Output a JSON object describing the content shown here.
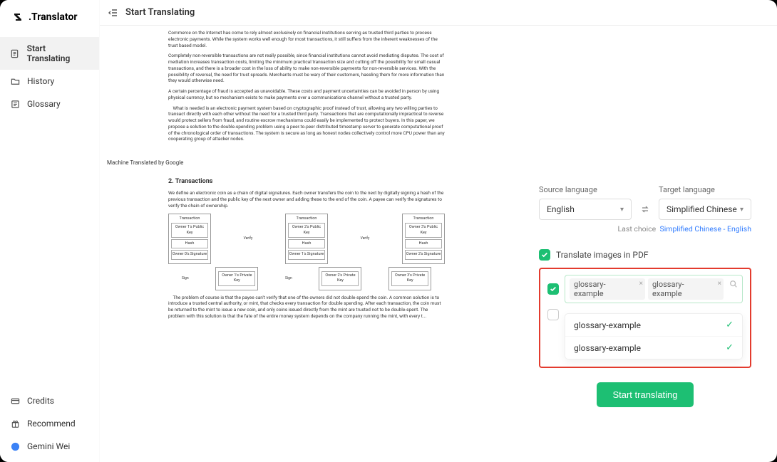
{
  "app_name": ".Translator",
  "topbar_title": "Start Translating",
  "sidebar": {
    "items": [
      {
        "label": "Start Translating",
        "icon": "document-icon",
        "active": true
      },
      {
        "label": "History",
        "icon": "folder-icon",
        "active": false
      },
      {
        "label": "Glossary",
        "icon": "list-icon",
        "active": false
      }
    ],
    "bottom": [
      {
        "label": "Credits",
        "icon": "card-icon"
      },
      {
        "label": "Recommend",
        "icon": "gift-icon"
      },
      {
        "label": "Gemini Wei",
        "icon": "avatar-icon"
      }
    ]
  },
  "document": {
    "para1": "Commerce on the Internet has come to rely almost exclusively on financial institutions serving as trusted third parties to process electronic payments. While the system works well enough for most transactions, it still suffers from the inherent weaknesses of the trust based model.",
    "para2": "Completely non-reversible transactions are not really possible, since financial institutions cannot avoid mediating disputes. The cost of mediation increases transaction costs, limiting the minimum practical transaction size and cutting off the possibility for small casual transactions, and there is a broader cost in the loss of ability to make non-reversible payments for non-reversible services. With the possibility of reversal, the need for trust spreads. Merchants must be wary of their customers, hassling them for more information than they would otherwise need.",
    "para3": "A certain percentage of fraud is accepted as unavoidable. These costs and payment uncertainties can be avoided in person by using physical currency, but no mechanism exists to make payments over a communications channel without a trusted party.",
    "para4": "    What is needed is an electronic payment system based on cryptographic proof instead of trust, allowing any two willing parties to transact directly with each other without the need for a trusted third party. Transactions that are computationally impractical to reverse would protect sellers from fraud, and routine escrow mechanisms could easily be implemented to protect buyers. In this paper, we propose a solution to the double-spending problem using a peer-to-peer distributed timestamp server to generate computational proof of the chronological order of transactions. The system is secure as long as honest nodes collectively control more CPU power than any cooperating group of attacker nodes.",
    "note": "Machine Translated by Google",
    "h2": "2. Transactions",
    "para5": "We define an electronic coin as a chain of digital signatures. Each owner transfers the coin to the next by digitally signing a hash of the previous transaction and the public key of the next owner and adding these to the end of the coin. A payee can verify the signatures to verify the chain of ownership.",
    "diagram": {
      "tx_label": "Transaction",
      "owner1_pub": "Owner 1's Public Key",
      "owner2_pub": "Owner 2's Public Key",
      "owner3_pub": "Owner 3's Public Key",
      "hash": "Hash",
      "owner0_sig": "Owner 0's Signature",
      "owner1_sig": "Owner 1's Signature",
      "owner2_sig": "Owner 2's Signature",
      "verify": "Verify",
      "sign": "Sign",
      "owner1_priv": "Owner 1's Private Key",
      "owner2_priv": "Owner 2's Private Key",
      "owner3_priv": "Owner 3's Private Key"
    },
    "para6": "    The problem of course is that the payee can't verify that one of the owners did not double-spend the coin. A common solution is to introduce a trusted central authority, or mint, that checks every transaction for double spending. After each transaction, the coin must be returned to the mint to issue a new coin, and only coins issued directly from the mint are trusted not to be double-spent. The problem with this solution is that the fate of the entire money system depends on the company running the mint, with every t..."
  },
  "panel": {
    "source_label": "Source language",
    "target_label": "Target language",
    "source_value": "English",
    "target_value": "Simplified Chinese",
    "last_choice_prefix": "Last choice",
    "last_choice_link": "Simplified Chinese - English",
    "translate_images_label": "Translate images in PDF",
    "glossary_tags": [
      "glossary-example",
      "glossary-example"
    ],
    "glossary_options": [
      "glossary-example",
      "glossary-example"
    ],
    "start_btn": "Start translating"
  }
}
